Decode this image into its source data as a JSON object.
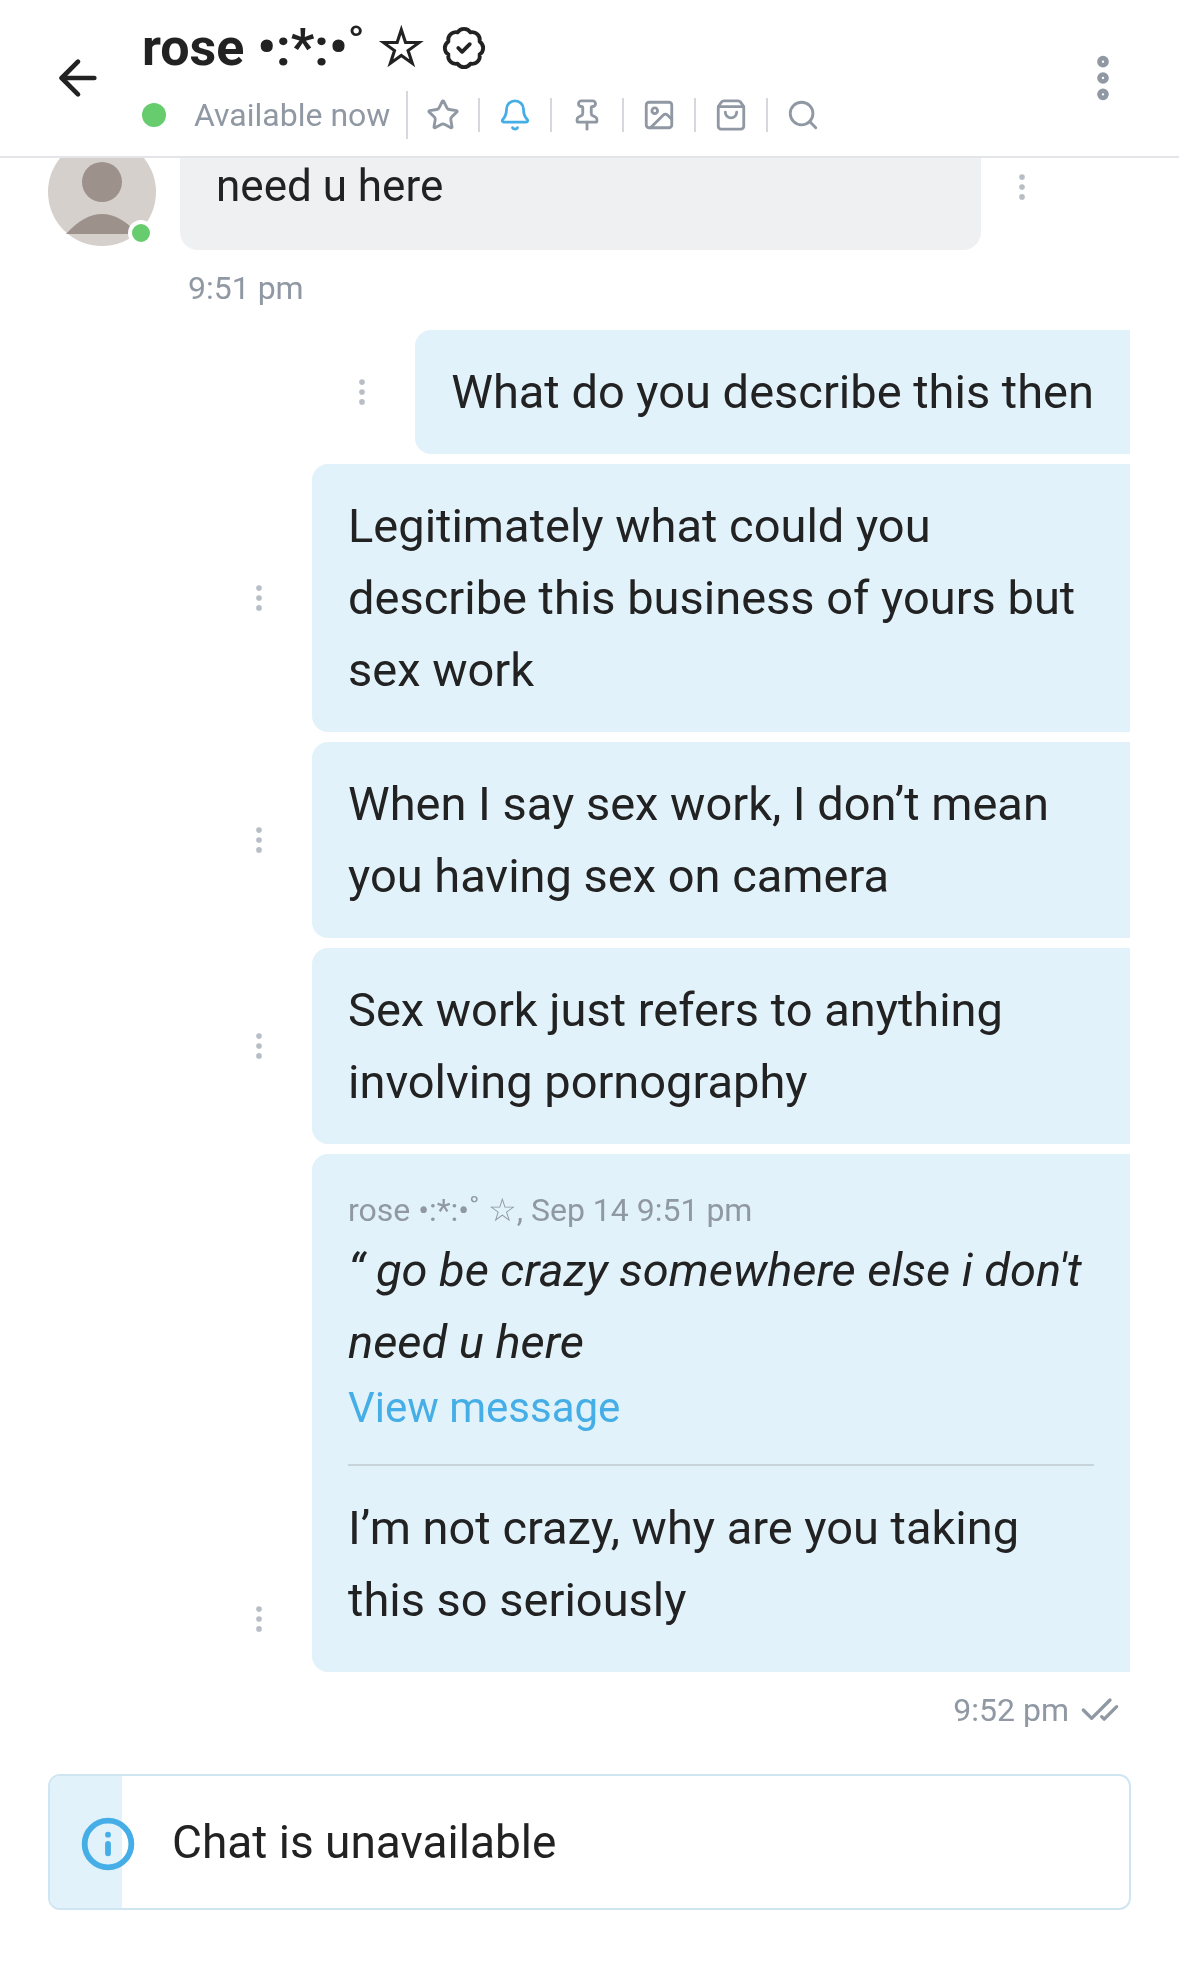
{
  "header": {
    "title": "rose •:*:•˚ ☆",
    "verified": true,
    "status": "Available now",
    "online": true,
    "tools": [
      {
        "kind": "star",
        "selected": false
      },
      {
        "kind": "bell",
        "selected": true
      },
      {
        "kind": "pin",
        "selected": false
      },
      {
        "kind": "image",
        "selected": false
      },
      {
        "kind": "bag",
        "selected": false
      },
      {
        "kind": "search",
        "selected": false
      }
    ]
  },
  "messages": [
    {
      "kind": "received",
      "text": "need u here",
      "online": true
    },
    {
      "kind": "time_received",
      "text": "9:51 pm"
    },
    {
      "kind": "sent",
      "text": "What do you describe this then"
    },
    {
      "kind": "sent",
      "text": "Legitimately what could you describe this business of yours but sex work"
    },
    {
      "kind": "sent",
      "text": "When I say sex work, I don’t mean you having sex on camera"
    },
    {
      "kind": "sent",
      "text": "Sex work just refers to anything involving pornography"
    },
    {
      "kind": "reply",
      "quote_meta": "rose •:*:•˚ ☆, Sep 14 9:51 pm",
      "quote": "“ go be crazy somewhere else i don't need u here",
      "link": "View message",
      "text": "I’m not crazy, why are you taking this so seriously"
    },
    {
      "kind": "time_sent",
      "text": "9:52 pm",
      "read": true
    }
  ],
  "notice": {
    "text": "Chat is unavailable"
  }
}
